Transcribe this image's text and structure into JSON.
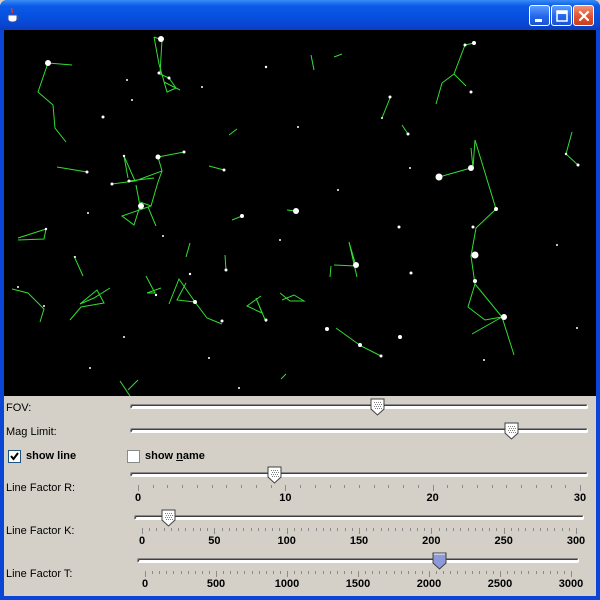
{
  "window": {
    "icon": "java-cup-icon",
    "controls": [
      "minimize-icon",
      "maximize-icon",
      "close-icon"
    ]
  },
  "colors": {
    "sky": "#000000",
    "star": "#ffffff",
    "constellation_line": "#33dd33",
    "panel": "#d4d0c8",
    "thumb_selected": "#8c9bd8"
  },
  "controls": {
    "fov": {
      "label": "FOV:",
      "fraction": 0.54
    },
    "mag_limit": {
      "label": "Mag Limit:",
      "fraction": 0.845
    },
    "show_line": {
      "label": "show line",
      "checked": true
    },
    "show_name": {
      "label": "show ",
      "mnemonic": "n",
      "label_rest": "ame",
      "checked": false
    },
    "line_factor_r": {
      "label": "Line Factor R:",
      "min": 0,
      "max": 30,
      "value": 9.2,
      "tick_labels": [
        "0",
        "10",
        "20",
        "30"
      ],
      "minor_ticks": 30
    },
    "line_factor_k": {
      "label": "Line Factor K:",
      "min": 0,
      "max": 300,
      "value": 18,
      "tick_labels": [
        "0",
        "50",
        "100",
        "150",
        "200",
        "250",
        "300"
      ],
      "minor_ticks": 60
    },
    "line_factor_t": {
      "label": "Line Factor T:",
      "min": 0,
      "max": 3000,
      "value": 2070,
      "tick_labels": [
        "0",
        "500",
        "1000",
        "1500",
        "2000",
        "2500",
        "3000"
      ],
      "minor_ticks": 60
    }
  }
}
